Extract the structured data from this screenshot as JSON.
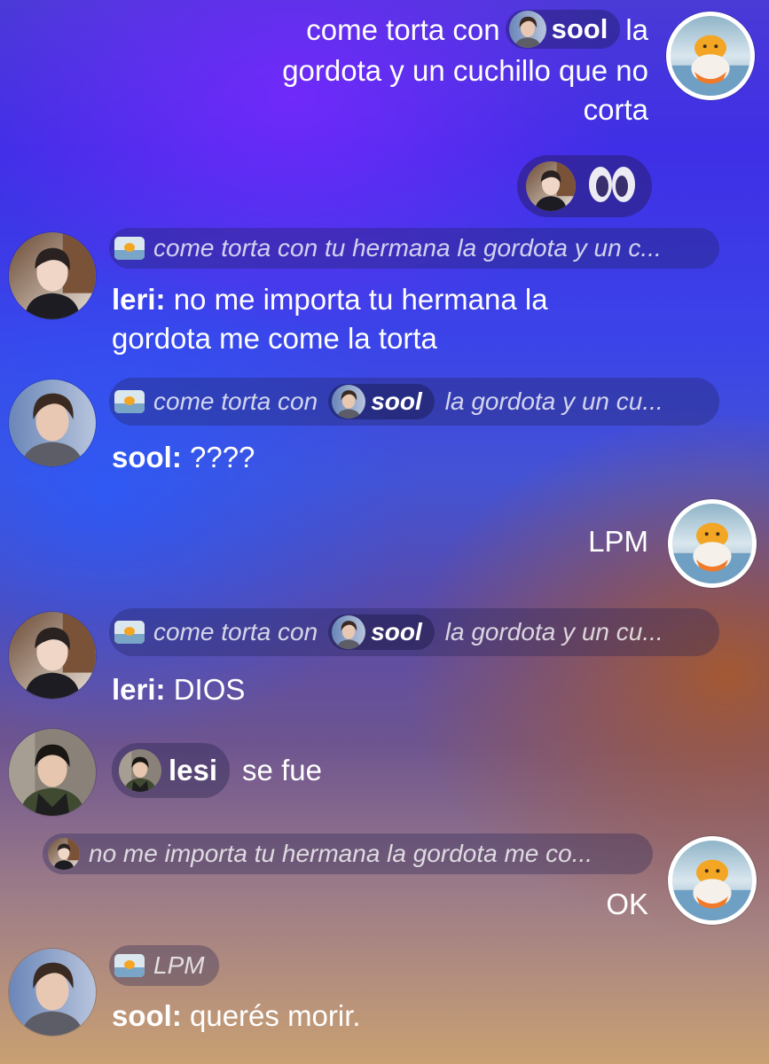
{
  "colors": {
    "chip_bg": "rgba(30,30,80,0.32)",
    "text": "#ffffff"
  },
  "messages": [
    {
      "id": "m1",
      "side": "right",
      "pre_mention": "come torta con",
      "mention": "sool",
      "post_mention": "la",
      "rest": "gordota y un cuchillo que no corta",
      "rest_lines": [
        "gordota y un cuchillo que no",
        "corta"
      ]
    },
    {
      "id": "m2",
      "side": "left",
      "reply_preview": "come torta con tu hermana la gordota y un c...",
      "author": "leri:",
      "text": "no me importa tu hermana la gordota me come la torta",
      "lines": [
        "no me importa tu hermana la",
        "gordota me come la torta"
      ]
    },
    {
      "id": "m3",
      "side": "left",
      "reply_pre": "come torta con",
      "reply_mention": "sool",
      "reply_post": "la gordota y un cu...",
      "author": "sool:",
      "text": "????"
    },
    {
      "id": "m4",
      "side": "right",
      "text": "LPM"
    },
    {
      "id": "m5",
      "side": "left",
      "reply_pre": "come torta con",
      "reply_mention": "sool",
      "reply_post": "la gordota y un cu...",
      "author": "leri:",
      "text": "DIOS"
    },
    {
      "id": "sys1",
      "type": "system",
      "name": "lesi",
      "text": "se fue"
    },
    {
      "id": "m6",
      "side": "right",
      "reply_preview": "no me importa tu hermana la gordota me co...",
      "text": "OK"
    },
    {
      "id": "m7",
      "side": "left",
      "reply_preview": "LPM",
      "author": "sool:",
      "text": "querés morir."
    }
  ],
  "icons": {
    "reaction_emoji": "big-eyes-emoji-icon",
    "avatar_me": "duck-in-pool-avatar-icon"
  }
}
